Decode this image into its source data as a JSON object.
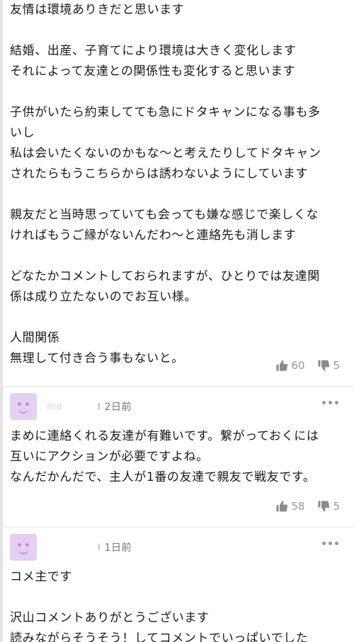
{
  "comments": [
    {
      "paragraphs": [
        [
          "友情は環境ありきだと思います"
        ],
        [
          "結婚、出産、子育てにより環境は大きく変化します",
          "それによって友達との関係性も変化すると思います"
        ],
        [
          "子供がいたら約束してても急にドタキャンになる事も多",
          "いし",
          "私は会いたくないのかもな〜と考えたりしてドタキャン",
          "されたらもうこちらからは誘わないようにしています"
        ],
        [
          "親友だと当時思っていても会っても嫌な感じで楽しくな",
          "ければもうご縁がないんだわ〜と連絡先も消します"
        ],
        [
          "どなたかコメントしておられますが、ひとりでは友達関",
          "係は成り立たないのでお互い様。"
        ],
        [
          "人間関係",
          "無理して付き合う事もないと。"
        ]
      ],
      "likes": "60",
      "dislikes": "5"
    },
    {
      "username": "mo",
      "time": "2日前",
      "paragraphs": [
        [
          "まめに連絡くれる友達が有難いです。繋がっておくには",
          "互いにアクションが必要ですよね。",
          "なんだかんだで、主人が1番の友達で親友で戦友です。"
        ]
      ],
      "likes": "58",
      "dislikes": "5"
    },
    {
      "username": "",
      "time": "1日前",
      "paragraphs": [
        [
          "コメ主です"
        ],
        [
          "沢山コメントありがとうございます",
          "読みながらそうそう！してコメントでいっぱいでした"
        ]
      ]
    }
  ],
  "separator": "I",
  "icons": {
    "like": "thumbs-up-icon",
    "dislike": "thumbs-down-icon",
    "more": "more-horizontal-icon"
  },
  "colors": {
    "avatar_bg": "#e6cff3",
    "avatar_face": "#c28adc",
    "muted_text": "#999999"
  }
}
